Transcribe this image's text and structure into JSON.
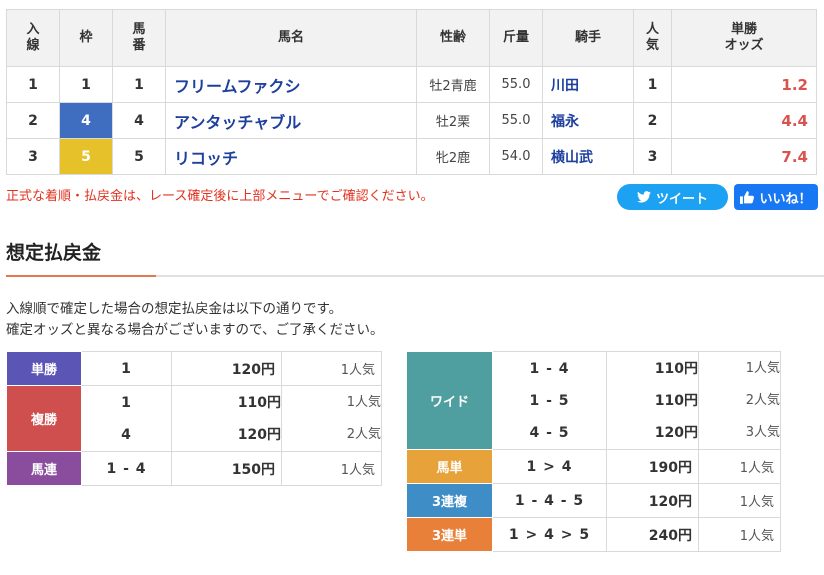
{
  "results": {
    "headers": {
      "finish_line1": "入",
      "finish_line2": "線",
      "frame": "枠",
      "number_line1": "馬",
      "number_line2": "番",
      "horse": "馬名",
      "sex_age": "性齢",
      "weight": "斤量",
      "jockey": "騎手",
      "popularity_line1": "人",
      "popularity_line2": "気",
      "odds_line1": "単勝",
      "odds_line2": "オッズ"
    },
    "rows": [
      {
        "finish": "1",
        "frame": "1",
        "number": "1",
        "horse": "フリームファクシ",
        "sex_age": "牡2青鹿",
        "weight": "55.0",
        "jockey": "川田",
        "popularity": "1",
        "odds": "1.2"
      },
      {
        "finish": "2",
        "frame": "4",
        "number": "4",
        "horse": "アンタッチャブル",
        "sex_age": "牡2栗",
        "weight": "55.0",
        "jockey": "福永",
        "popularity": "2",
        "odds": "4.4"
      },
      {
        "finish": "3",
        "frame": "5",
        "number": "5",
        "horse": "リコッチ",
        "sex_age": "牝2鹿",
        "weight": "54.0",
        "jockey": "横山武",
        "popularity": "3",
        "odds": "7.4"
      }
    ]
  },
  "notice": "正式な着順・払戻金は、レース確定後に上部メニューでご確認ください。",
  "share": {
    "tweet": "ツイート",
    "like": "いいね！"
  },
  "section": {
    "title": "想定払戻金",
    "desc1": "入線順で確定した場合の想定払戻金は以下の通りです。",
    "desc2": "確定オッズと異なる場合がございますので、ご了承ください。"
  },
  "payouts_left": {
    "win": {
      "label": "単勝",
      "color": "#5b55b5",
      "combo": "1",
      "amount": "120円",
      "popularity": "1人気"
    },
    "place": {
      "label": "複勝",
      "color": "#cf4e4e",
      "entries": [
        {
          "combo": "1",
          "amount": "110円",
          "popularity": "1人気"
        },
        {
          "combo": "4",
          "amount": "120円",
          "popularity": "2人気"
        }
      ]
    },
    "quinella": {
      "label": "馬連",
      "color": "#8a4d9e",
      "combo": "1 - 4",
      "amount": "150円",
      "popularity": "1人気"
    }
  },
  "payouts_right": {
    "wide": {
      "label": "ワイド",
      "color": "#4f9fa1",
      "entries": [
        {
          "combo": "1 - 4",
          "amount": "110円",
          "popularity": "1人気"
        },
        {
          "combo": "1 - 5",
          "amount": "110円",
          "popularity": "2人気"
        },
        {
          "combo": "4 - 5",
          "amount": "120円",
          "popularity": "3人気"
        }
      ]
    },
    "exacta": {
      "label": "馬単",
      "color": "#e8a23a",
      "combo": "1 > 4",
      "amount": "190円",
      "popularity": "1人気"
    },
    "trio": {
      "label": "3連複",
      "color": "#3f8dc7",
      "combo": "1 - 4 - 5",
      "amount": "120円",
      "popularity": "1人気"
    },
    "trifecta": {
      "label": "3連単",
      "color": "#e8803a",
      "combo": "1 > 4 > 5",
      "amount": "240円",
      "popularity": "1人気"
    }
  }
}
